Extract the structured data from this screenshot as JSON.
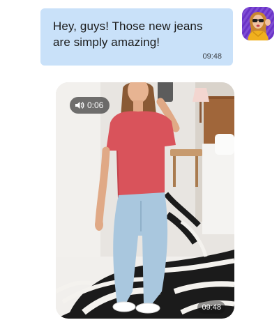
{
  "message": {
    "text": "Hey, guys! Those new jeans are simply amazing!",
    "time": "09:48",
    "bubble_color": "#c9e1f9"
  },
  "avatar": {
    "icon": "user-avatar-photo",
    "background": "#6a33c6"
  },
  "video_message": {
    "duration": "0:06",
    "time": "09:48",
    "sound_icon": "speaker-icon",
    "photo": "mirror-selfie-red-top-light-jeans"
  }
}
